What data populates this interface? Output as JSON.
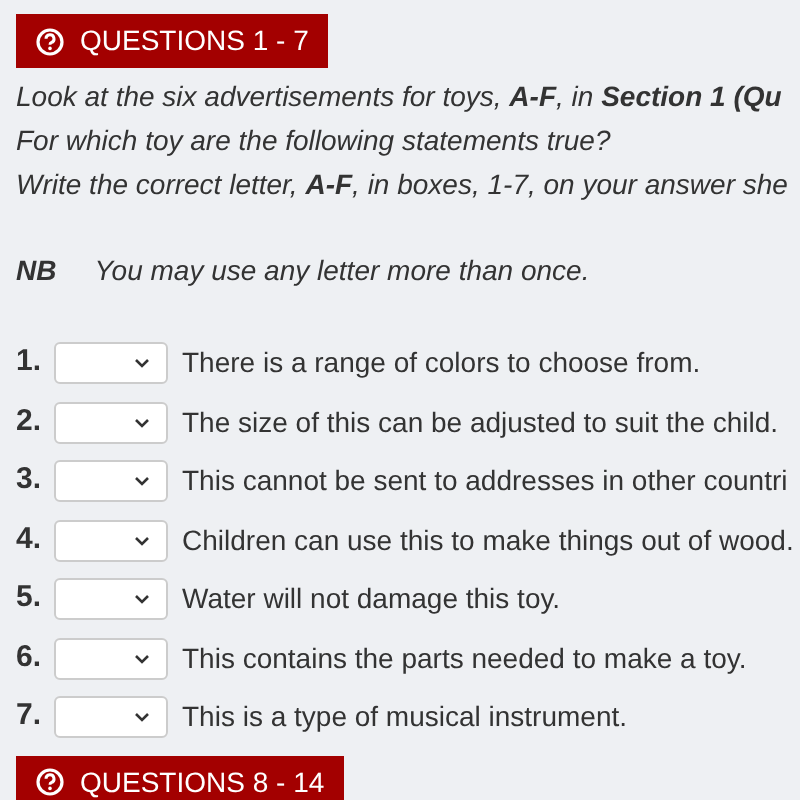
{
  "header": {
    "label": "QUESTIONS 1 - 7"
  },
  "instructions": [
    "Look at the six advertisements for toys, **A-F**, in **Section 1 (Qu**",
    "For which toy are the following statements true?",
    "Write the correct letter, **A-F**, in boxes, 1-7, on your answer she"
  ],
  "note": {
    "label": "NB",
    "text": "You may use any letter more than once."
  },
  "questions": [
    {
      "number": "1.",
      "text": "There is a range of colors to choose from."
    },
    {
      "number": "2.",
      "text": "The size of this can be adjusted to suit the child."
    },
    {
      "number": "3.",
      "text": "This cannot be sent to addresses in other countri"
    },
    {
      "number": "4.",
      "text": "Children can use this to make things out of wood."
    },
    {
      "number": "5.",
      "text": "Water will not damage this toy."
    },
    {
      "number": "6.",
      "text": "This contains the parts needed to make a toy."
    },
    {
      "number": "7.",
      "text": "This is a type of musical instrument."
    }
  ],
  "next_header": {
    "label": "QUESTIONS 8 - 14"
  }
}
